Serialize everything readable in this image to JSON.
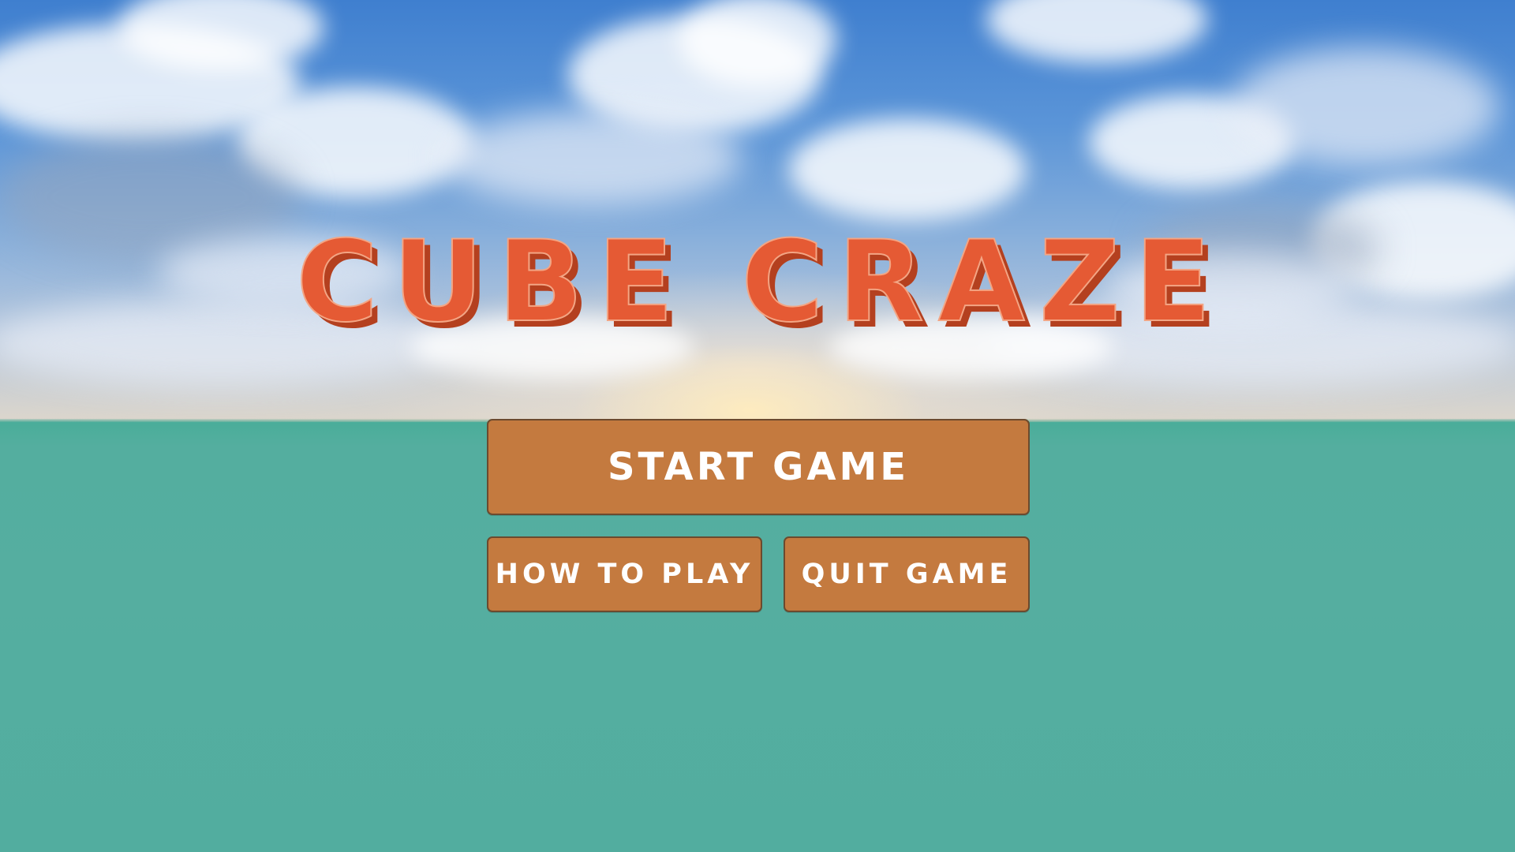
{
  "title": "CUBE CRAZE",
  "buttons": {
    "start_label": "START GAME",
    "how_label": "HOW TO PLAY",
    "quit_label": "QUIT GAME"
  },
  "colors": {
    "title": "#e55a34",
    "title_shadow": "#b4401f",
    "button_fill": "#c47a3f",
    "button_border": "#6c4a2e",
    "button_text": "#ffffff",
    "sea": "#55aea0",
    "sky": "#5b95d8"
  }
}
